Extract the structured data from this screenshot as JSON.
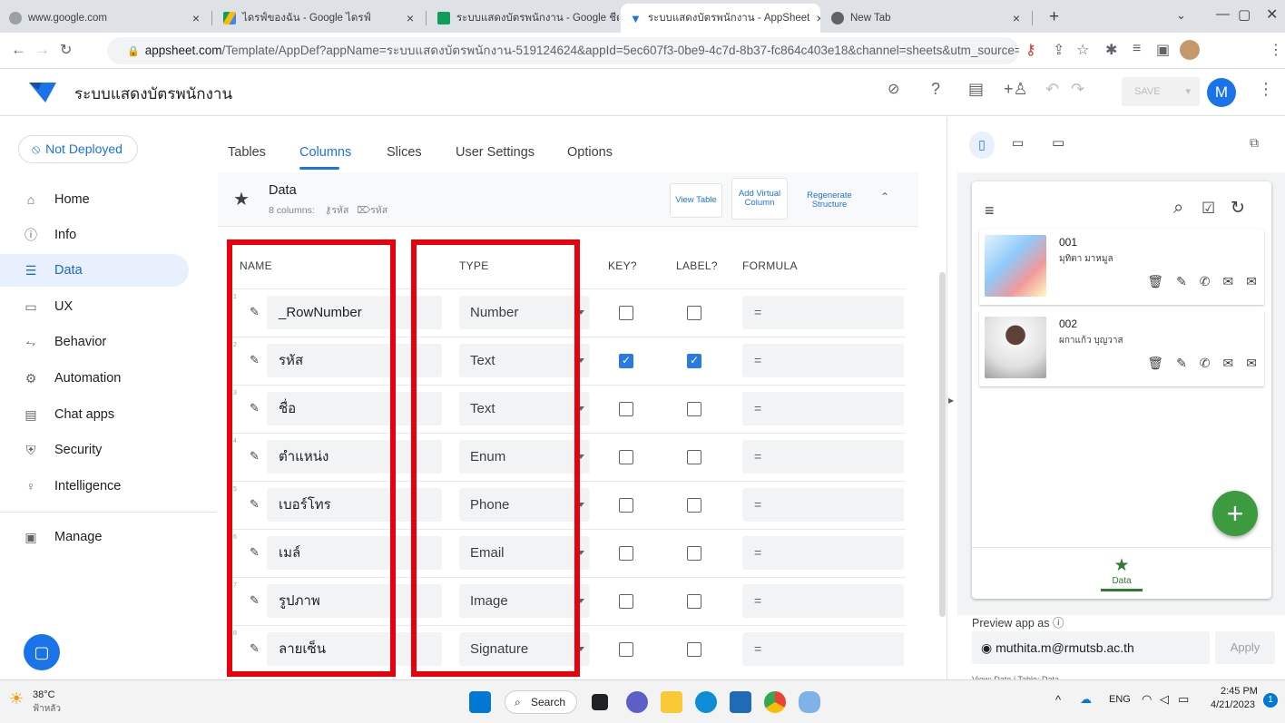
{
  "browser": {
    "tabs": [
      {
        "title": "www.google.com"
      },
      {
        "title": "ไดรฟ์ของฉัน - Google ไดรฟ์"
      },
      {
        "title": "ระบบแสดงบัตรพนักงาน - Google ชีต"
      },
      {
        "title": "ระบบแสดงบัตรพนักงาน - AppSheet"
      },
      {
        "title": "New Tab"
      }
    ],
    "close_glyph": "×",
    "new_tab_glyph": "+",
    "url_domain": "appsheet.com",
    "url_rest": "/Template/AppDef?appName=ระบบแสดงบัตรพนักงาน-519124624&appId=5ec607f3-0be9-4c7d-8b37-fc864c403e18&channel=sheets&utm_source=sheets_tools&utm_..."
  },
  "app": {
    "title": "ระบบแสดงบัตรพนักงาน",
    "save_label": "SAVE",
    "avatar_letter": "M"
  },
  "sidebar": {
    "status": "Not Deployed",
    "items": [
      {
        "label": "Home",
        "icon": "home-icon"
      },
      {
        "label": "Info",
        "icon": "info-icon"
      },
      {
        "label": "Data",
        "icon": "data-icon",
        "selected": true
      },
      {
        "label": "UX",
        "icon": "ux-icon"
      },
      {
        "label": "Behavior",
        "icon": "behavior-icon"
      },
      {
        "label": "Automation",
        "icon": "automation-icon"
      },
      {
        "label": "Chat apps",
        "icon": "chat-apps-icon"
      },
      {
        "label": "Security",
        "icon": "security-icon"
      },
      {
        "label": "Intelligence",
        "icon": "intelligence-icon"
      },
      {
        "label": "Manage",
        "icon": "manage-icon"
      }
    ]
  },
  "subtabs": [
    "Tables",
    "Columns",
    "Slices",
    "User Settings",
    "Options"
  ],
  "data_card": {
    "title": "Data",
    "columns_count": "8 columns:",
    "key_name": "รหัส",
    "label_name": "รหัส",
    "view_table": "View Table",
    "add_virtual": "Add Virtual Column",
    "regenerate": "Regenerate Structure"
  },
  "table": {
    "headers": {
      "name": "NAME",
      "type": "TYPE",
      "key": "KEY?",
      "label": "LABEL?",
      "formula": "FORMULA"
    },
    "rows": [
      {
        "num": "1",
        "name": "_RowNumber",
        "type": "Number",
        "key": false,
        "label": false,
        "formula": "="
      },
      {
        "num": "2",
        "name": "รหัส",
        "type": "Text",
        "key": true,
        "label": true,
        "formula": "="
      },
      {
        "num": "3",
        "name": "ชื่อ",
        "type": "Text",
        "key": false,
        "label": false,
        "formula": "="
      },
      {
        "num": "4",
        "name": "ตำแหน่ง",
        "type": "Enum",
        "key": false,
        "label": false,
        "formula": "="
      },
      {
        "num": "5",
        "name": "เบอร์โทร",
        "type": "Phone",
        "key": false,
        "label": false,
        "formula": "="
      },
      {
        "num": "6",
        "name": "เมล์",
        "type": "Email",
        "key": false,
        "label": false,
        "formula": "="
      },
      {
        "num": "7",
        "name": "รูปภาพ",
        "type": "Image",
        "key": false,
        "label": false,
        "formula": "="
      },
      {
        "num": "8",
        "name": "ลายเซ็น",
        "type": "Signature",
        "key": false,
        "label": false,
        "formula": "="
      }
    ]
  },
  "preview": {
    "records": [
      {
        "id": "001",
        "name": "มุทิตา มาหมูล"
      },
      {
        "id": "002",
        "name": "ผกาแก้ว บุญวาส"
      }
    ],
    "nav_label": "Data",
    "preview_as_label": "Preview app as",
    "preview_email": "muthita.m@rmutsb.ac.th",
    "apply_label": "Apply",
    "footer": "View: Data | Table: Data"
  },
  "taskbar": {
    "temp": "38°C",
    "weather": "ฟ้าหลัว",
    "search": "Search",
    "lang": "ENG",
    "time": "2:45 PM",
    "date": "4/21/2023",
    "badge": "1"
  }
}
